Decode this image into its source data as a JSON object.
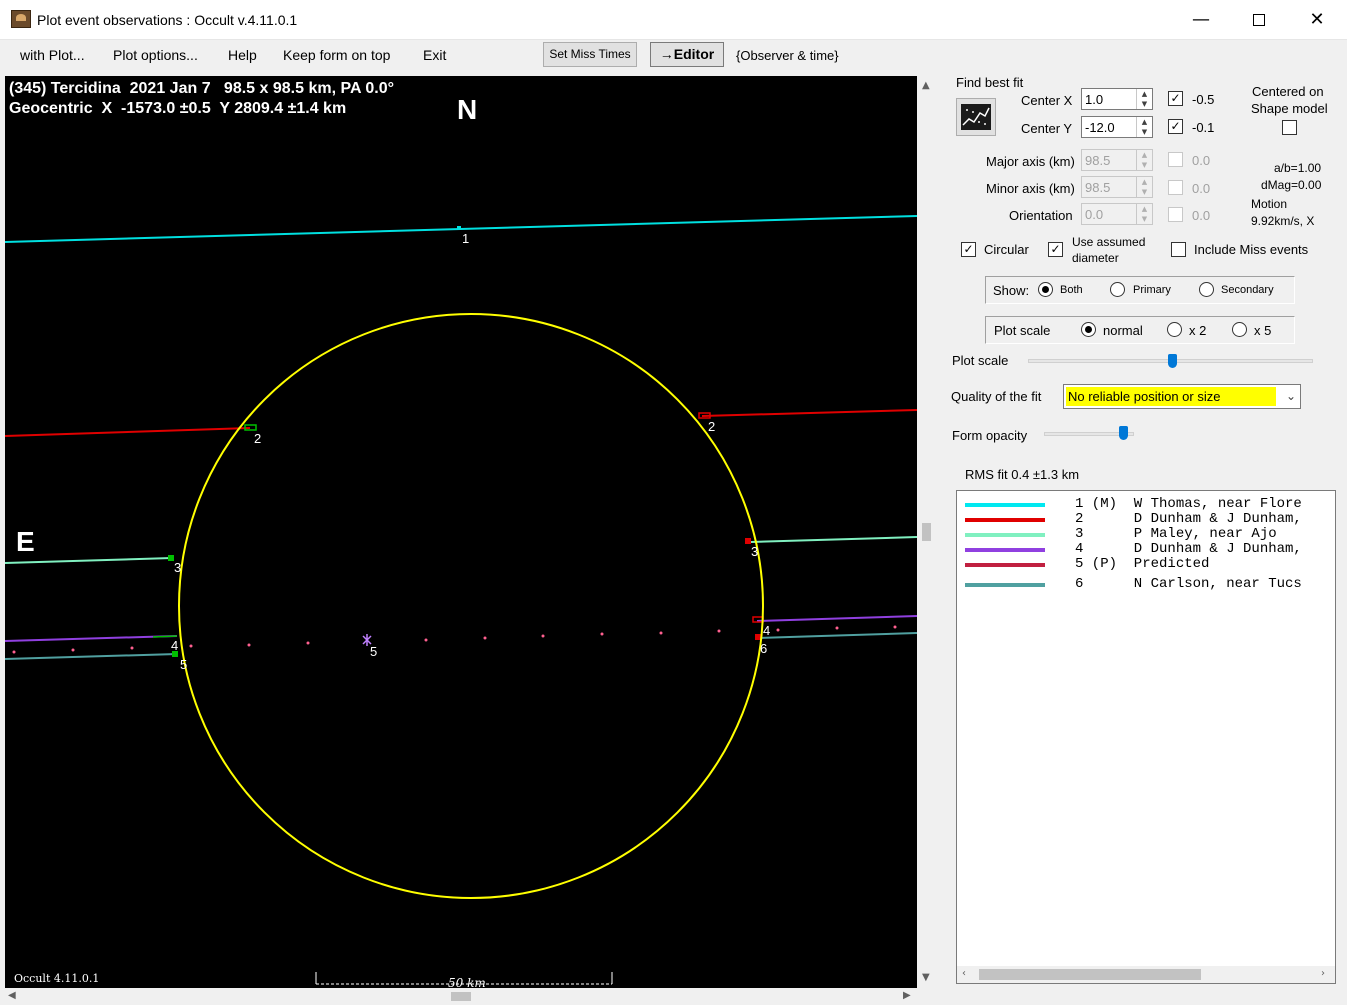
{
  "window": {
    "title": "Plot event observations : Occult v.4.11.0.1",
    "min_glyph": "—",
    "close_glyph": "✕"
  },
  "menu": {
    "items": [
      "with Plot...",
      "Plot options...",
      "Help",
      "Keep form on top",
      "Exit"
    ],
    "set_miss_times": "Set Miss Times",
    "editor": "→Editor",
    "observer_time": "{Observer & time}"
  },
  "plot": {
    "header_line1": "(345) Tercidina  2021 Jan 7   98.5 x 98.5 km, PA 0.0°",
    "header_line2": "Geocentric  X  -1573.0 ±0.5  Y 2809.4 ±1.4 km",
    "north": "N",
    "east": "E",
    "version": "Occult 4.11.0.1",
    "scale_bar": "50 km",
    "chord_labels": [
      "1",
      "2",
      "2",
      "3",
      "3",
      "4",
      "4",
      "5",
      "5",
      "6"
    ],
    "colors": {
      "outline": "#ffff00",
      "chord1": "#00e0e0",
      "chord2": "#e00000",
      "chord3": "#80f0c0",
      "chord4": "#9040e0",
      "chord5": "#c02040",
      "chord6": "#50a0a0"
    }
  },
  "panel": {
    "find_best_fit": "Find best fit",
    "center_x_label": "Center X",
    "center_x_value": "1.0",
    "center_x_fit": "-0.5",
    "center_y_label": "Center Y",
    "center_y_value": "-12.0",
    "center_y_fit": "-0.1",
    "centered_on": "Centered on",
    "shape_model": "Shape model",
    "major_axis_label": "Major axis (km)",
    "major_axis_value": "98.5",
    "major_axis_fit": "0.0",
    "minor_axis_label": "Minor axis (km)",
    "minor_axis_value": "98.5",
    "minor_axis_fit": "0.0",
    "orientation_label": "Orientation",
    "orientation_value": "0.0",
    "orientation_fit": "0.0",
    "ab_ratio": "a/b=1.00",
    "dmag": "dMag=0.00",
    "motion_label": "Motion",
    "motion_value": "9.92km/s, X",
    "circular": "Circular",
    "use_assumed": "Use assumed",
    "diameter": "diameter",
    "include_miss": "Include Miss events",
    "show_label": "Show:",
    "show_both": "Both",
    "show_primary": "Primary",
    "show_secondary": "Secondary",
    "plot_scale_group": "Plot scale",
    "scale_normal": "normal",
    "scale_x2": "x 2",
    "scale_x5": "x 5",
    "plot_scale_slider": "Plot scale",
    "quality_label": "Quality of the fit",
    "quality_value": "No reliable position or size",
    "form_opacity": "Form opacity",
    "rms_fit": "RMS fit  0.4 ±1.3 km"
  },
  "observers": [
    {
      "text": "1 (M)  W Thomas, near Flore",
      "color": "#00e8f0"
    },
    {
      "text": "2      D Dunham & J Dunham,",
      "color": "#e00000"
    },
    {
      "text": "3      P Maley, near Ajo",
      "color": "#80f0c0"
    },
    {
      "text": "4      D Dunham & J Dunham,",
      "color": "#9040e0"
    },
    {
      "text": "5 (P)  Predicted",
      "color": "#c02040"
    },
    {
      "text": "6      N Carlson, near Tucs",
      "color": "#50a0a0"
    }
  ]
}
